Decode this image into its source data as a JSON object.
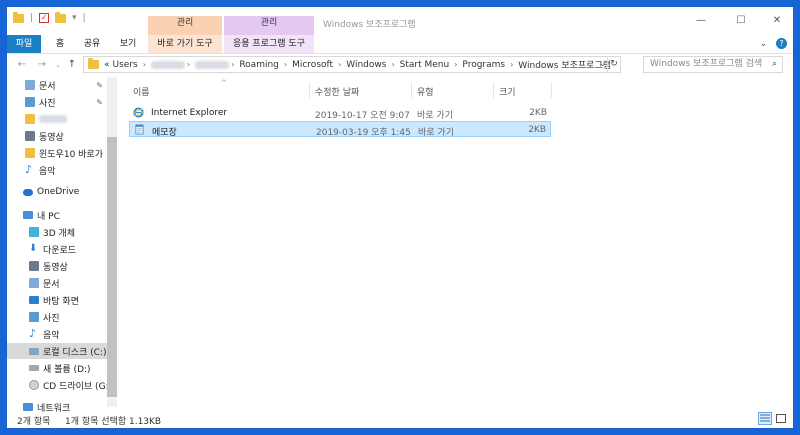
{
  "titlebar": {
    "title": "Windows 보조프로그램",
    "ctx_manage_1": "관리",
    "ctx_manage_2": "관리",
    "minimize": "—",
    "maximize": "☐",
    "close": "✕"
  },
  "ribbon": {
    "tabs": [
      "파일",
      "홈",
      "공유",
      "보기",
      "바로 가기 도구",
      "응용 프로그램 도구"
    ],
    "collapse": "⌄",
    "help": "?"
  },
  "address": {
    "prefix": "«",
    "crumbs": [
      "Users",
      "Roaming",
      "Microsoft",
      "Windows",
      "Start Menu",
      "Programs",
      "Windows 보조프로그램"
    ],
    "search_placeholder": "Windows 보조프로그램 검색"
  },
  "sidebar": {
    "items": [
      {
        "label": "문서",
        "icon": "documents-icon"
      },
      {
        "label": "사진",
        "icon": "pictures-icon"
      },
      {
        "label": "동영상",
        "icon": "videos-icon"
      },
      {
        "label": "윈도우10 바로가",
        "icon": "folder-icon"
      },
      {
        "label": "음악",
        "icon": "music-icon"
      },
      {
        "label": "OneDrive",
        "icon": "onedrive-icon"
      },
      {
        "label": "내 PC",
        "icon": "pc-icon"
      },
      {
        "label": "3D 개체",
        "icon": "3d-objects-icon"
      },
      {
        "label": "다운로드",
        "icon": "downloads-icon"
      },
      {
        "label": "동영상",
        "icon": "videos-icon"
      },
      {
        "label": "문서",
        "icon": "documents-icon"
      },
      {
        "label": "바탕 화면",
        "icon": "desktop-icon"
      },
      {
        "label": "사진",
        "icon": "pictures-icon"
      },
      {
        "label": "음악",
        "icon": "music-icon"
      },
      {
        "label": "로컬 디스크 (C:)",
        "icon": "drive-icon"
      },
      {
        "label": "새 볼륨 (D:)",
        "icon": "drive-icon"
      },
      {
        "label": "CD 드라이브 (G:",
        "icon": "cd-drive-icon"
      },
      {
        "label": "네트워크",
        "icon": "network-icon"
      }
    ]
  },
  "columns": [
    "이름",
    "수정한 날짜",
    "유형",
    "크기"
  ],
  "files": [
    {
      "name": "Internet Explorer",
      "date": "2019-10-17 오전 9:07",
      "type": "바로 가기",
      "size": "2KB",
      "icon": "internet-explorer-icon"
    },
    {
      "name": "메모장",
      "date": "2019-03-19 오후 1:45",
      "type": "바로 가기",
      "size": "2KB",
      "icon": "notepad-icon"
    }
  ],
  "status": {
    "count": "2개 항목",
    "selection": "1개 항목 선택함 1.13KB"
  },
  "colors": {
    "accent": "#1a7fc3",
    "desktop": "#1565d8",
    "selection": "#cce8ff"
  }
}
